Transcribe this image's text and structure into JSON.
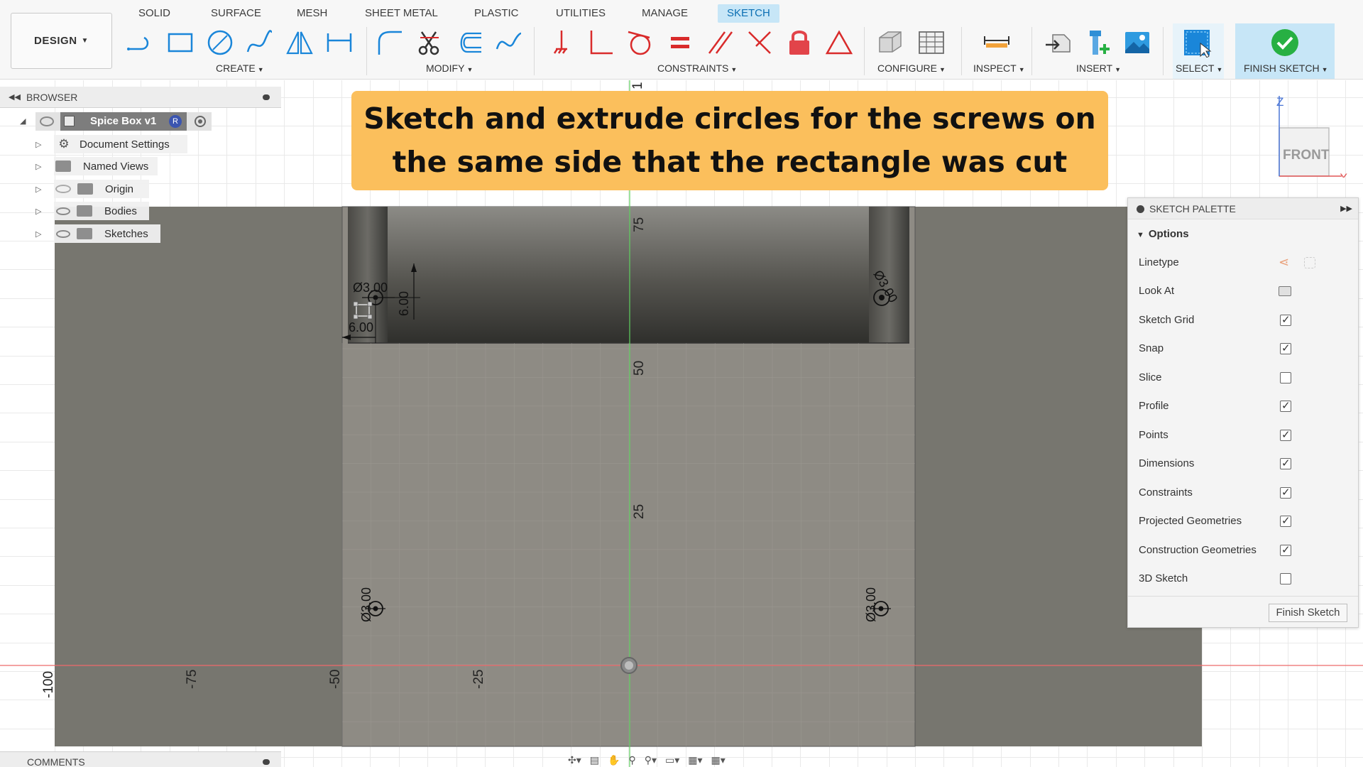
{
  "ribbon": {
    "workspace": "DESIGN",
    "tabs": [
      "SOLID",
      "SURFACE",
      "MESH",
      "SHEET METAL",
      "PLASTIC",
      "UTILITIES",
      "MANAGE",
      "SKETCH"
    ],
    "active_tab": "SKETCH",
    "groups": {
      "create": "CREATE",
      "modify": "MODIFY",
      "constraints": "CONSTRAINTS",
      "configure": "CONFIGURE",
      "inspect": "INSPECT",
      "insert": "INSERT",
      "select": "SELECT",
      "finish": "FINISH SKETCH"
    }
  },
  "browser": {
    "title": "BROWSER",
    "root": {
      "label": "Spice Box v1",
      "badge": "R"
    },
    "items": [
      {
        "label": "Document Settings",
        "icon": "gear-icon"
      },
      {
        "label": "Named Views",
        "icon": "folder-icon"
      },
      {
        "label": "Origin",
        "icon": "folder-icon",
        "hidden": true
      },
      {
        "label": "Bodies",
        "icon": "folder-icon"
      },
      {
        "label": "Sketches",
        "icon": "folder-icon"
      }
    ]
  },
  "banner": {
    "line1": "Sketch and extrude circles for the screws on",
    "line2": "the same side that the rectangle was cut"
  },
  "sketch": {
    "dimensions": {
      "dia_top_left": "Ø3.00",
      "offset_vertical": "6.00",
      "offset_horizontal": "6.00",
      "dia_top_right": "Ø3.00",
      "dia_bottom_left": "Ø3.00",
      "dia_bottom_right": "Ø3.00"
    },
    "axis_labels_vertical": [
      "75",
      "50",
      "25"
    ],
    "axis_labels_horizontal": [
      "-100",
      "-75",
      "-50",
      "-25"
    ]
  },
  "viewcube": {
    "face": "FRONT",
    "axis_z": "Z",
    "axis_x": "X"
  },
  "palette": {
    "title": "SKETCH PALETTE",
    "section": "Options",
    "options": [
      {
        "label": "Linetype",
        "type": "icons"
      },
      {
        "label": "Look At",
        "type": "icon"
      },
      {
        "label": "Sketch Grid",
        "checked": true
      },
      {
        "label": "Snap",
        "checked": true
      },
      {
        "label": "Slice",
        "checked": false
      },
      {
        "label": "Profile",
        "checked": true
      },
      {
        "label": "Points",
        "checked": true
      },
      {
        "label": "Dimensions",
        "checked": true
      },
      {
        "label": "Constraints",
        "checked": true
      },
      {
        "label": "Projected Geometries",
        "checked": true
      },
      {
        "label": "Construction Geometries",
        "checked": true
      },
      {
        "label": "3D Sketch",
        "checked": false
      }
    ],
    "finish_button": "Finish Sketch"
  },
  "comments": {
    "title": "COMMENTS"
  },
  "colors": {
    "accent_blue": "#0b6fb3",
    "active_tab_bg": "#c7e6f7",
    "banner": "#fbbf5c",
    "finish_check": "#27b043",
    "body_face": "#8d8a82",
    "model_dark": "#77766f"
  }
}
